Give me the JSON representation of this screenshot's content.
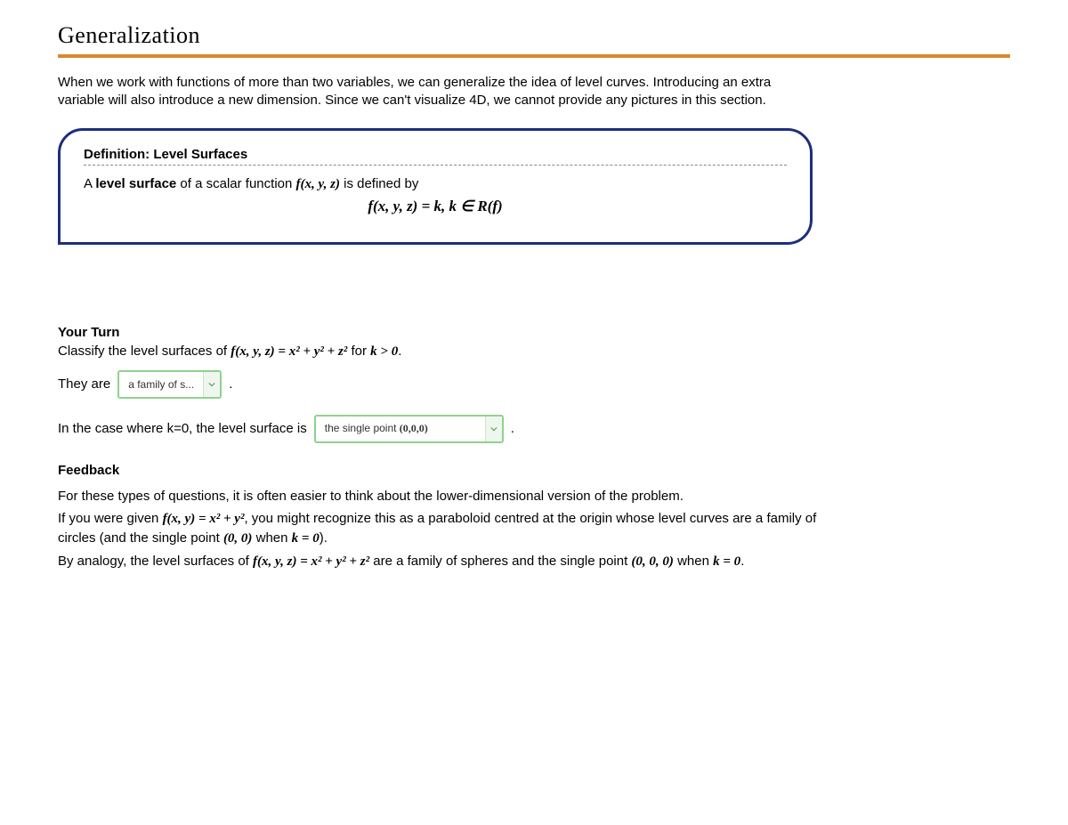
{
  "title": "Generalization",
  "intro": "When we work with functions of more than two variables, we can generalize the idea of level curves. Introducing an extra variable will also introduce a new dimension. Since we can't visualize 4D, we cannot provide any pictures in this section.",
  "definition": {
    "heading": "Definition: Level Surfaces",
    "line1_a": "A ",
    "line1_bold": "level surface",
    "line1_b": " of a scalar function ",
    "line1_math": "f(x, y, z)",
    "line1_c": " is defined by",
    "eq": "f(x, y, z) = k,    k ∈ R(f)"
  },
  "yourturn": {
    "label": "Your Turn",
    "prompt_a": "Classify the level surfaces of ",
    "prompt_math": "f(x, y, z) = x² + y² + z²",
    "prompt_b": " for ",
    "prompt_math2": "k > 0",
    "prompt_c": ".",
    "row1_a": "They are",
    "select1": "a family of s...",
    "row1_b": ".",
    "row2_a": "In the case where k=0, the level surface is",
    "select2_a": "the single point ",
    "select2_b": "(0,0,0)",
    "row2_b": "."
  },
  "feedback": {
    "label": "Feedback",
    "p1": "For these types of questions, it is often easier to think about the lower-dimensional version of the problem.",
    "p2_a": "If you were given ",
    "p2_math1": "f(x, y) = x² + y²",
    "p2_b": ", you might recognize this as a paraboloid centred at the origin whose level curves are a family of circles (and the single point ",
    "p2_math2": "(0, 0)",
    "p2_c": " when ",
    "p2_math3": "k = 0",
    "p2_d": ").",
    "p3_a": "By analogy, the level surfaces of ",
    "p3_math1": "f(x, y, z) = x² + y² + z²",
    "p3_b": " are a family of spheres and the single point ",
    "p3_math2": "(0, 0, 0)",
    "p3_c": " when ",
    "p3_math3": "k = 0",
    "p3_d": "."
  }
}
